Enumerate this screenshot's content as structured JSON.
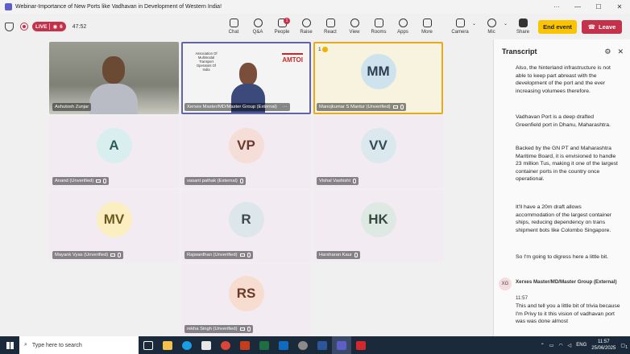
{
  "window": {
    "title": "Webinar-Importance of New Ports like Vadhavan in Development of Western India!"
  },
  "toolbar": {
    "live_label": "LIVE",
    "participants_count": "6",
    "elapsed": "47:52",
    "buttons": [
      {
        "label": "Chat",
        "icon": "chat-icon"
      },
      {
        "label": "Q&A",
        "icon": "qa-icon"
      },
      {
        "label": "People",
        "icon": "people-icon",
        "badge": "1"
      },
      {
        "label": "Raise",
        "icon": "hand-icon"
      },
      {
        "label": "React",
        "icon": "smile-icon"
      },
      {
        "label": "View",
        "icon": "grid-icon"
      },
      {
        "label": "Rooms",
        "icon": "rooms-icon"
      },
      {
        "label": "Apps",
        "icon": "apps-icon"
      },
      {
        "label": "More",
        "icon": "more-icon"
      }
    ],
    "camera": "Camera",
    "mic": "Mic",
    "share": "Share",
    "end_event": "End event",
    "leave": "Leave"
  },
  "tiles": [
    {
      "name": "Ashutosh Zunjar",
      "initials": "",
      "video": true
    },
    {
      "name": "Xerxes Master/MD/Master Group (External)",
      "initials": "",
      "video": true,
      "slide_text": "Association Of Multimodal Transport Operators Of India",
      "logo": "AMTOI"
    },
    {
      "name": "Manojkumar S Mantur (Unverified)",
      "initials": "MM",
      "hand_raised": "1"
    },
    {
      "name": "Anand (Unverified)",
      "initials": "A"
    },
    {
      "name": "vasant pathak (External)",
      "initials": "VP"
    },
    {
      "name": "Vishal Vashisht",
      "initials": "VV"
    },
    {
      "name": "Mayank Vyas (Unverified)",
      "initials": "MV"
    },
    {
      "name": "Rajwardhan (Unverified)",
      "initials": "R"
    },
    {
      "name": "Harsharan Kaur",
      "initials": "HK"
    },
    {
      "name": "rekha Singh (Unverified)",
      "initials": "RS"
    }
  ],
  "transcript": {
    "title": "Transcript",
    "paragraphs": [
      "Also, the hinterland infrastructure is not able to keep part abreast with the development of the port and the ever increasing volumees therefore.",
      "Vadhavan Port is a deep drafted Greenfield port in Dhanu, Maharashtra.",
      "Backed by the GN PT and Maharashtra Maritime Board, it is envisioned to handle 23 million Tus, making it one of the largest container ports in the country once operational.",
      "It'll have a 20m draft allows accommodation of the largest container ships, reducing dependency on trans shipment bots like Colombo Singapore.",
      "So I'm going to digress here a little bit."
    ],
    "speaker": {
      "initials": "XG",
      "name": "Xerxes Master/MD/Master Group (External)",
      "time": "11:57",
      "text": "This and tell you a little bit of trivia because I'm Privy to it this vision of vadhavan port was was done almost"
    }
  },
  "taskbar": {
    "search_placeholder": "Type here to search",
    "lang": "ENG",
    "time": "11:57",
    "date": "25/06/2025",
    "notifications": "1"
  }
}
